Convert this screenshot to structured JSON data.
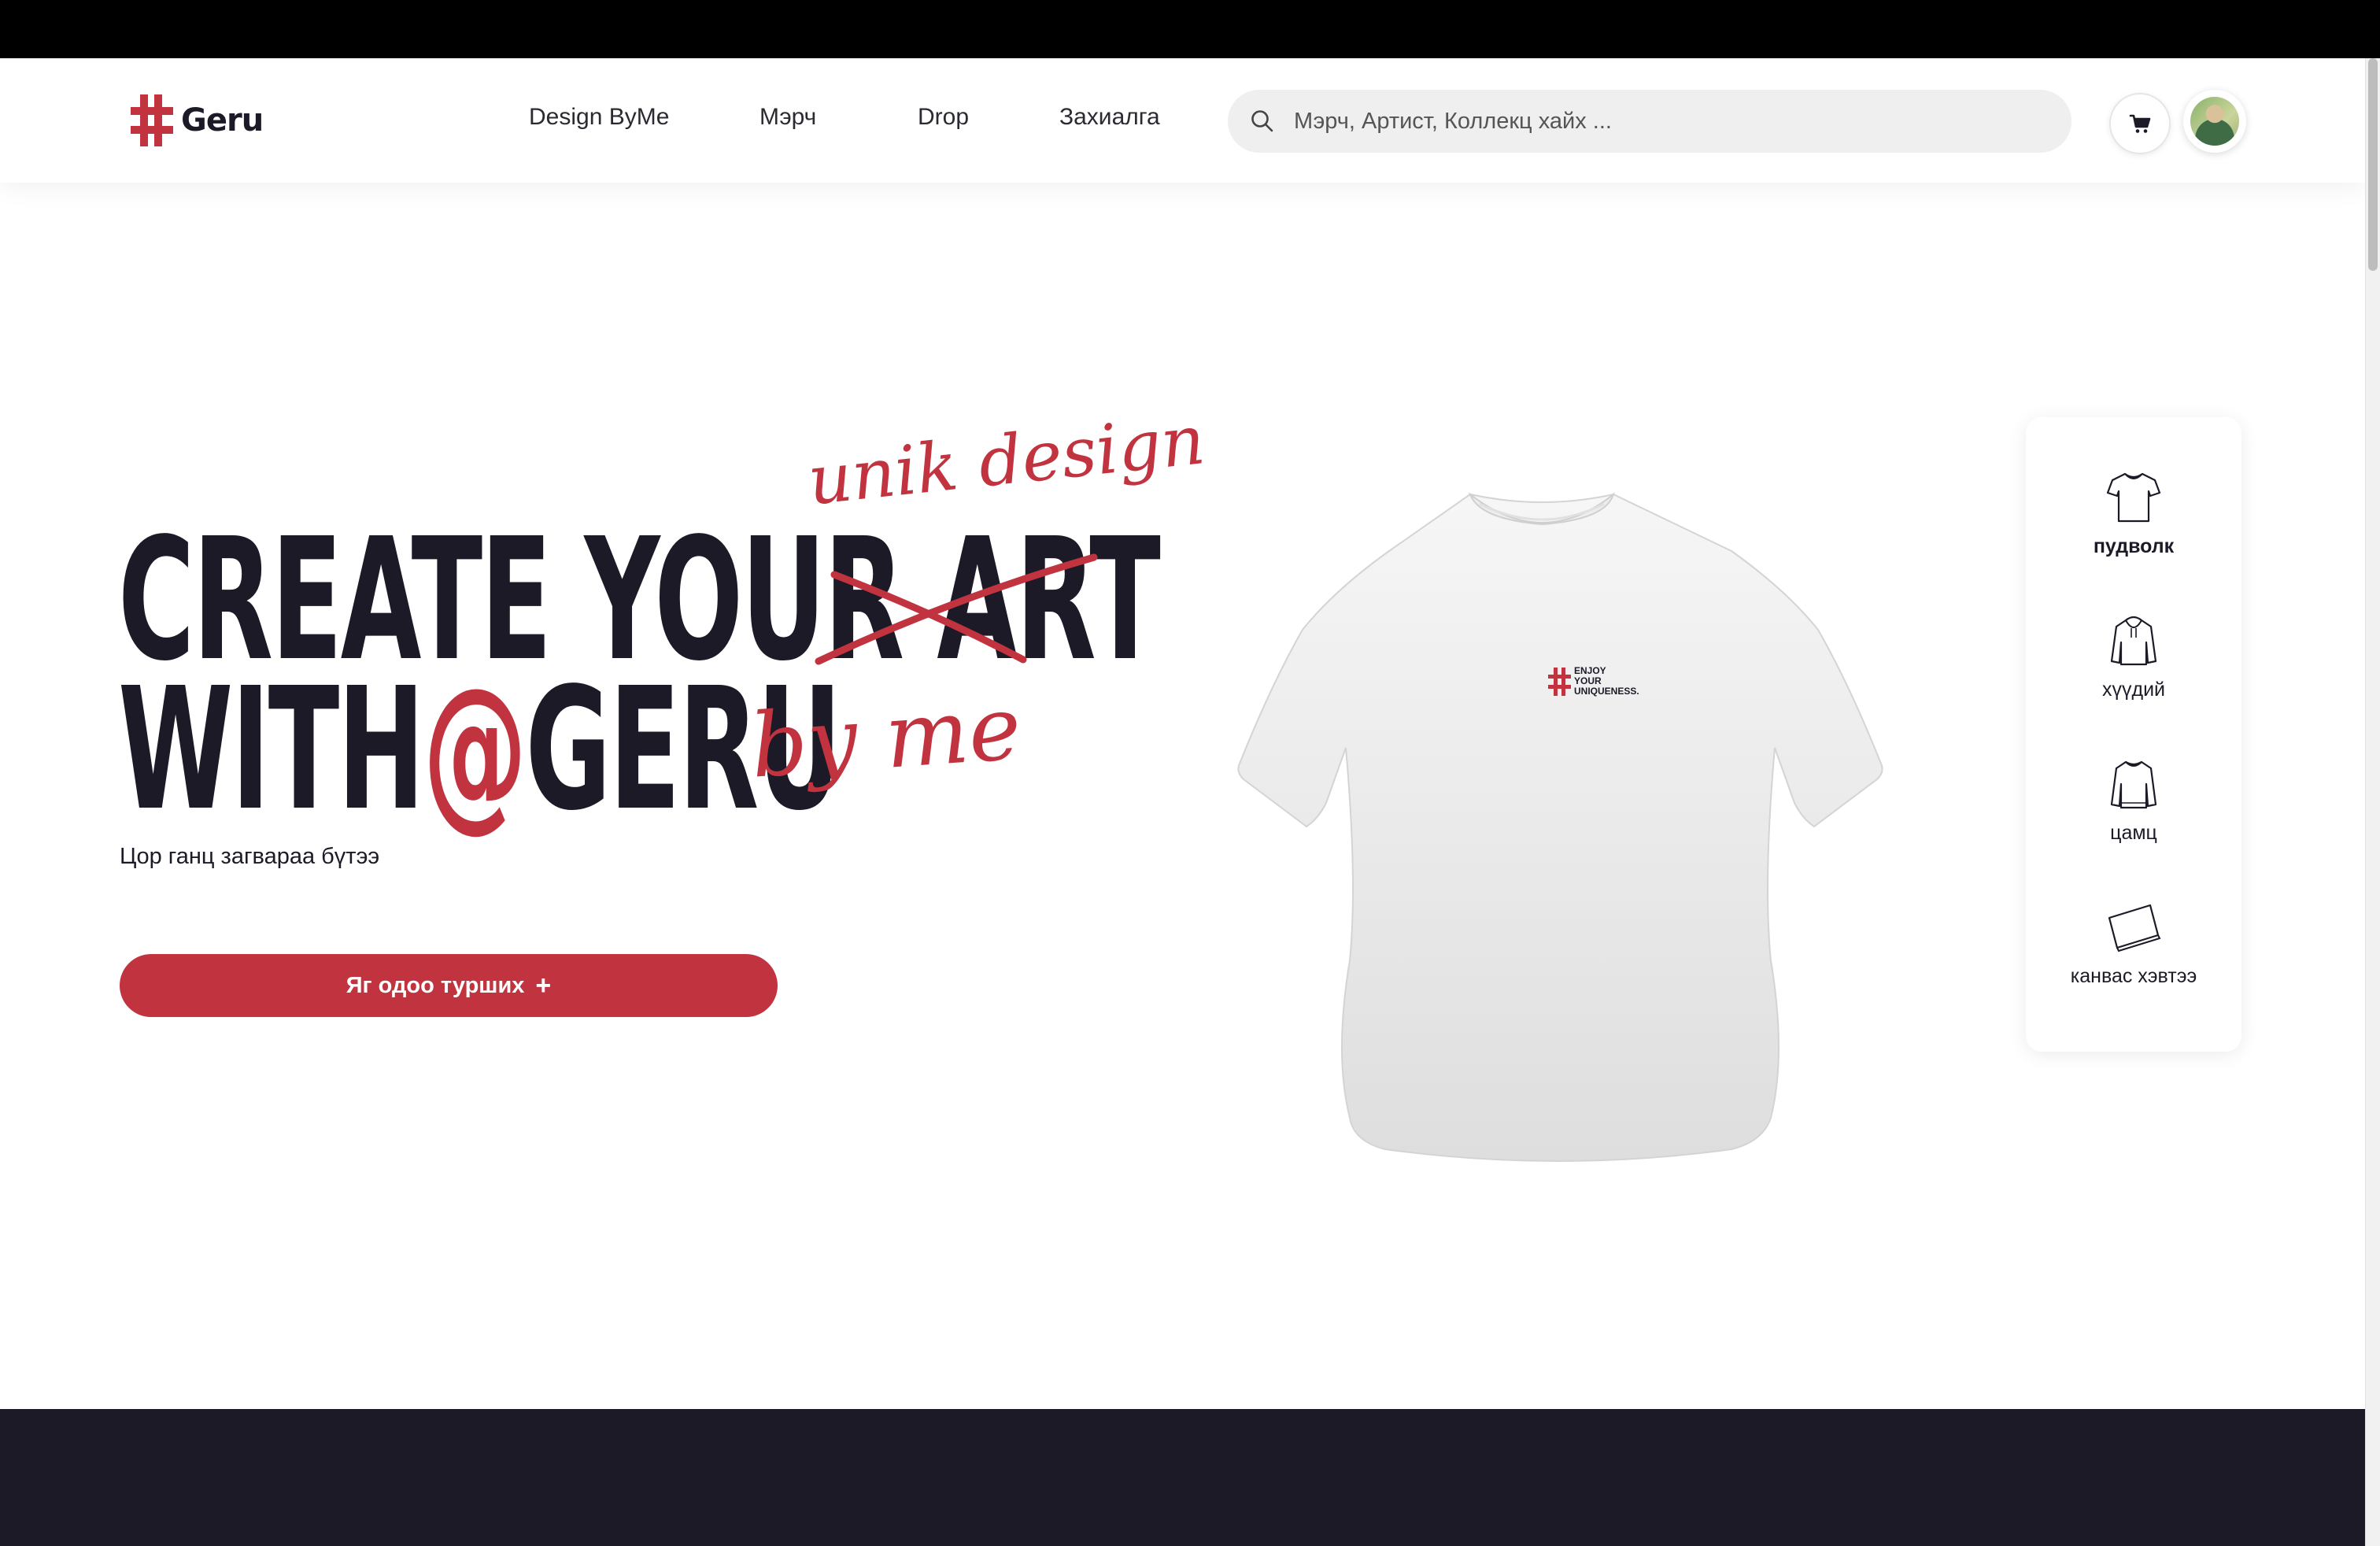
{
  "brand": {
    "name": "Geru",
    "accent_color": "#c0333f",
    "dark_color": "#1c1a27"
  },
  "nav": {
    "links": [
      "Design ByMe",
      "Мэрч",
      "Drop",
      "Захиалга"
    ]
  },
  "search": {
    "placeholder": "Мэрч, Артист, Коллекц хайх ..."
  },
  "header_icons": {
    "cart": "cart-icon",
    "avatar": "user-avatar"
  },
  "hero": {
    "title_line1_a": "CREATE YOUR",
    "title_line1_struck": "ART",
    "title_line2_a": "WITH",
    "title_line2_at": "@",
    "title_line2_b": "GERU",
    "script_top": "unik design",
    "script_bottom": "by me",
    "subtitle": "Цор ганц загвараа бүтээ",
    "cta_label": "Яг одоо турших",
    "cta_icon": "+"
  },
  "product_preview": {
    "print_line1": "ENJOY",
    "print_line2": "YOUR",
    "print_line3": "UNIQUENESS."
  },
  "categories": [
    {
      "label": "пудволк",
      "icon": "tshirt-icon",
      "active": true
    },
    {
      "label": "хүүдий",
      "icon": "hoodie-icon",
      "active": false
    },
    {
      "label": "цамц",
      "icon": "sweater-icon",
      "active": false
    },
    {
      "label": "канвас хэвтээ",
      "icon": "canvas-icon",
      "active": false
    }
  ]
}
